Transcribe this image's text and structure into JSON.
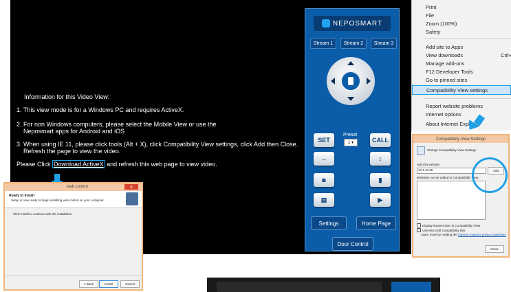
{
  "video_info": {
    "heading": "Information for this Video View:",
    "item1": "1. This view mode is for a Windows PC and requires ActiveX.",
    "item2_line1": "2. For non Windows computers, please select the Mobile View or use the",
    "item2_line2": "Neposmart apps for Android and iOS",
    "item3_line1": "3. When using IE 11, please click tools (Alt + X), click Compatibility View settings, click Add then Close.",
    "item3_line2": "Refresh the page to view the video.",
    "please_prefix": "Please Click",
    "download_link": "Download ActiveX",
    "please_suffix": "and refresh this web page to view video."
  },
  "panel": {
    "logo": "NEPOSMART",
    "streams": [
      "Stream 1",
      "Stream 2",
      "Stream 3"
    ],
    "set": "SET",
    "preset": "Preset",
    "preset_value": "1",
    "call": "CALL",
    "settings": "Settings",
    "home_page": "Home Page",
    "door_control": "Door Control"
  },
  "ie_menu": {
    "items_top": [
      "Print",
      "File",
      "Zoom (100%)",
      "Safety"
    ],
    "items_mid": [
      "Add site to Apps",
      "View downloads",
      "Manage add-ons",
      "F12 Developer Tools",
      "Go to pinned sites"
    ],
    "view_downloads_shortcut": "Ctrl+",
    "highlighted": "Compatibility View settings",
    "items_bottom": [
      "Report website problems",
      "Internet options",
      "About Internet Explorer"
    ]
  },
  "compat_dialog": {
    "title": "Compatibility View Settings",
    "change_label": "Change Compatibility View Settings",
    "add_label": "Add this website:",
    "add_value": "10.1.10.25",
    "add_button": "Add",
    "list_label": "Websites you've added to Compatibility View:",
    "check1": "Display intranet sites in Compatibility View",
    "check2": "Use Microsoft compatibility lists",
    "learn_prefix": "Learn more by reading the",
    "learn_link": "Internet Explorer privacy statement",
    "close_button": "Close"
  },
  "installer": {
    "title": "web control",
    "heading": "Ready to Install",
    "subheading": "Setup is now ready to begin installing web control on your computer.",
    "body": "Click Install to continue with the installation.",
    "back_button": "< Back",
    "install_button": "Install",
    "cancel_button": "Cancel"
  },
  "colors": {
    "accent": "#1fa0e6",
    "panel": "#0b5da9"
  }
}
